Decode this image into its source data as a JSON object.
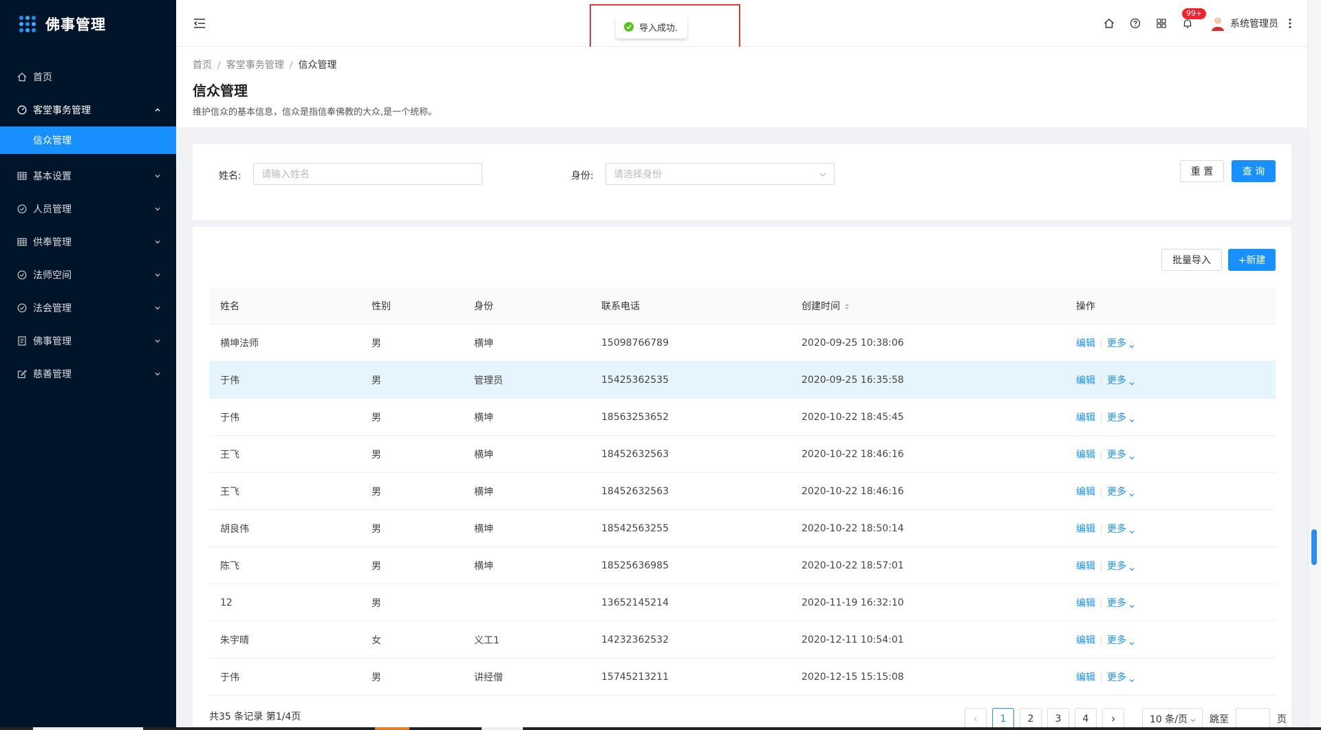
{
  "app": {
    "title": "佛事管理"
  },
  "colors": {
    "primary": "#1890ff",
    "sidebar_bg": "#001529",
    "success": "#52c41a",
    "danger": "#f5222d"
  },
  "sidebar": {
    "items": [
      {
        "label": "首页",
        "icon": "home-icon"
      },
      {
        "label": "客堂事务管理",
        "icon": "dashboard-icon",
        "open": true,
        "children": [
          {
            "label": "信众管理",
            "active": true
          }
        ]
      },
      {
        "label": "基本设置",
        "icon": "table-icon"
      },
      {
        "label": "人员管理",
        "icon": "check-circle-icon"
      },
      {
        "label": "供奉管理",
        "icon": "table-icon"
      },
      {
        "label": "法师空间",
        "icon": "check-circle-icon"
      },
      {
        "label": "法会管理",
        "icon": "check-circle-icon"
      },
      {
        "label": "佛事管理",
        "icon": "profile-icon"
      },
      {
        "label": "慈善管理",
        "icon": "form-icon"
      }
    ]
  },
  "header": {
    "notification_badge": "99+",
    "username": "系统管理员"
  },
  "toast": {
    "message": "导入成功."
  },
  "breadcrumb": {
    "items": [
      "首页",
      "客堂事务管理",
      "信众管理"
    ]
  },
  "page": {
    "title": "信众管理",
    "description": "维护信众的基本信息，信众是指信奉佛教的大众,是一个统称。"
  },
  "search": {
    "name_label": "姓名:",
    "name_placeholder": "请输入姓名",
    "identity_label": "身份:",
    "identity_placeholder": "请选择身份",
    "reset_label": "重 置",
    "query_label": "查 询"
  },
  "toolbar": {
    "batch_import_label": "批量导入",
    "new_label": "+新建"
  },
  "table": {
    "columns": [
      "姓名",
      "性别",
      "身份",
      "联系电话",
      "创建时间",
      "操作"
    ],
    "edit_label": "编辑",
    "more_label": "更多",
    "rows": [
      {
        "name": "横坤法师",
        "gender": "男",
        "identity": "横坤",
        "phone": "15098766789",
        "created": "2020-09-25 10:38:06"
      },
      {
        "name": "于伟",
        "gender": "男",
        "identity": "管理员",
        "phone": "15425362535",
        "created": "2020-09-25 16:35:58",
        "highlight": true
      },
      {
        "name": "于伟",
        "gender": "男",
        "identity": "横坤",
        "phone": "18563253652",
        "created": "2020-10-22 18:45:45"
      },
      {
        "name": "王飞",
        "gender": "男",
        "identity": "横坤",
        "phone": "18452632563",
        "created": "2020-10-22 18:46:16"
      },
      {
        "name": "王飞",
        "gender": "男",
        "identity": "横坤",
        "phone": "18452632563",
        "created": "2020-10-22 18:46:16"
      },
      {
        "name": "胡良伟",
        "gender": "男",
        "identity": "横坤",
        "phone": "18542563255",
        "created": "2020-10-22 18:50:14"
      },
      {
        "name": "陈飞",
        "gender": "男",
        "identity": "横坤",
        "phone": "18525636985",
        "created": "2020-10-22 18:57:01"
      },
      {
        "name": "12",
        "gender": "男",
        "identity": "",
        "phone": "13652145214",
        "created": "2020-11-19 16:32:10"
      },
      {
        "name": "朱宇晴",
        "gender": "女",
        "identity": "义工1",
        "phone": "14232362532",
        "created": "2020-12-11 10:54:01"
      },
      {
        "name": "于伟",
        "gender": "男",
        "identity": "讲经僧",
        "phone": "15745213211",
        "created": "2020-12-15 15:15:08"
      }
    ]
  },
  "pagination": {
    "total_text": "共35 条记录 第1/4页",
    "pages": [
      "1",
      "2",
      "3",
      "4"
    ],
    "current": "1",
    "page_size": "10 条/页",
    "jump_label": "跳至",
    "page_unit": "页"
  }
}
